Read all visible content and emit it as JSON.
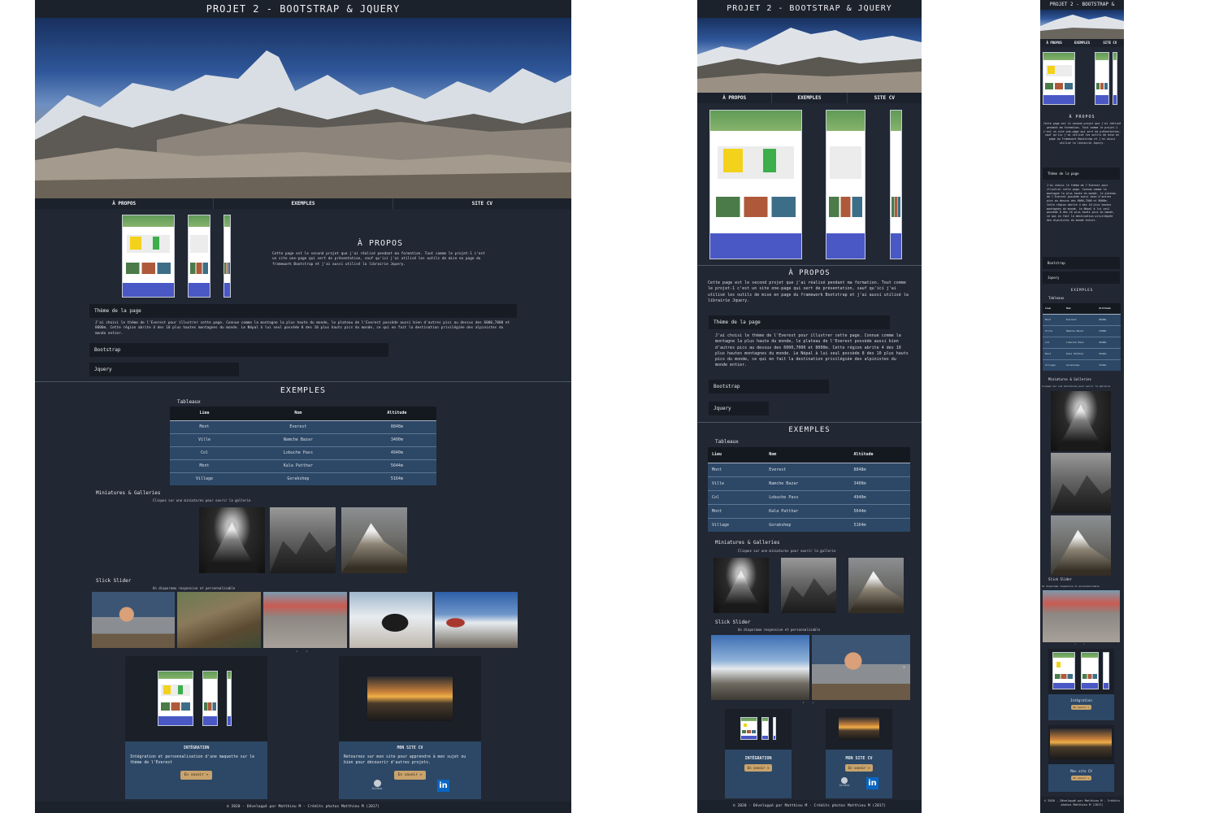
{
  "site_title": "PROJET 2 - BOOTSTRAP & JQUERY",
  "nav": {
    "about": "À PROPOS",
    "examples": "EXEMPLES",
    "cv": "SITE CV"
  },
  "about": {
    "title": "À PROPOS",
    "text": "Cette page est le second projet que j'ai réalisé pendant ma formation. Tout comme le projet-1 c'est un site one-page qui sert de présentation, sauf qu'ici j'ai utilisé les outils de mise en page du framework Bootstrap et j'ai aussi utilisé la librairie Jquery."
  },
  "accordion": {
    "theme_title": "Thème de la page",
    "theme_text": "J'ai choisi le thème de l'Everest pour illustrer cette page. Connue comme la montagne la plus haute du monde, le plateau de l'Everest possède aussi bien d'autres pics au dessus des 6000,7000 et 8000m. Cette région abrite 4 des 10 plus hautes montagnes du monde. Le Népal à lui seul possède 8 des 10 plus hauts pics du monde, ce qui en fait la destination privilégiée des alpinistes du monde entier.",
    "bootstrap": "Bootstrap",
    "jquery": "Jquery"
  },
  "examples": {
    "title": "EXEMPLES",
    "tables_label": "Tableaux",
    "table": {
      "headers": [
        "Lieu",
        "Nom",
        "Altitude"
      ],
      "rows": [
        [
          "Mont",
          "Everest",
          "8848m"
        ],
        [
          "Ville",
          "Namche Bazar",
          "3400m"
        ],
        [
          "Col",
          "Lobuche Pass",
          "4940m"
        ],
        [
          "Mont",
          "Kala Patthar",
          "5644m"
        ],
        [
          "Village",
          "Gorakshep",
          "5164m"
        ]
      ]
    },
    "gallery_label": "Miniatures & Galleries",
    "gallery_note": "Cliquez sur une miniatures pour ouvrir la gallerie",
    "slider_label": "Slick Slider",
    "slider_note": "Un diaporama responsive et personnalisable",
    "slider_dots": "• •"
  },
  "cards": {
    "integration_title": "INTÉGRATION",
    "integration_title_mobile": "Intégration",
    "integration_text": "Intégration et personnalisation d'une maquette sur le thème de l'Everest",
    "cv_title": "MON SITE CV",
    "cv_title_mobile": "Mon site CV",
    "cv_text": "Retournez sur mon site pour apprendre à mon sujet ou bien pour découvrir d'autres projets.",
    "button": "En savoir +",
    "github": "GitHub",
    "linkedin": "in"
  },
  "footer": "© 2020 - Développé par Matthieu M - Crédits photos Matthieu M (2017)",
  "colors": {
    "page_bg": "#212733",
    "header_bg": "#1c222c",
    "table_row": "#2d4866",
    "button": "#c9a36b",
    "accordion": "#171c24"
  }
}
